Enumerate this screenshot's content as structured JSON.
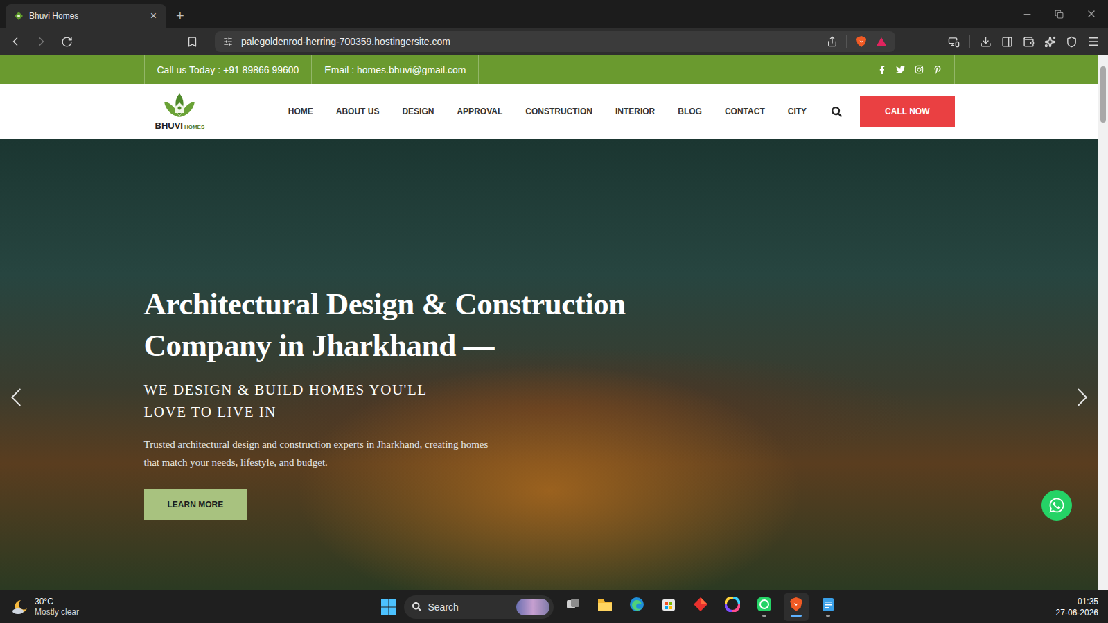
{
  "browser": {
    "tabs": [
      {
        "label": "Bhuvi Homes",
        "selected": true,
        "close": "×"
      }
    ],
    "new_tab": "+",
    "address": "palegoldenrod-herring-700359.hostingersite.com"
  },
  "site": {
    "topbar": {
      "phone": "Call us Today : +91 89866 99600",
      "email": "Email : homes.bhuvi@gmail.com"
    },
    "logo": {
      "name": "BHUVI",
      "suffix": "HOMES"
    },
    "nav": [
      "HOME",
      "ABOUT US",
      "DESIGN",
      "APPROVAL",
      "CONSTRUCTION",
      "INTERIOR",
      "BLOG",
      "CONTACT",
      "CITY"
    ],
    "cta": "CALL NOW",
    "hero": {
      "heading": [
        "Architectural Design & Construction",
        "Company in Jharkhand —"
      ],
      "subheading": [
        "WE DESIGN & BUILD HOMES YOU'LL",
        "LOVE TO LIVE IN"
      ],
      "text": [
        "Trusted architectural design and construction experts in Jharkhand, creating homes",
        "that match your needs, lifestyle, and budget."
      ],
      "button": "LEARN MORE"
    },
    "scrollbar": {
      "level": 0.11
    }
  },
  "taskbar": {
    "weather": {
      "temp": "30°C",
      "condition": "Mostly clear"
    },
    "search": "Search",
    "apps": [
      {
        "running": false,
        "active": false
      },
      {
        "running": false,
        "active": false
      },
      {
        "running": false,
        "active": false
      },
      {
        "running": false,
        "active": false
      },
      {
        "running": false,
        "active": false
      },
      {
        "running": false,
        "active": false
      },
      {
        "running": true,
        "active": false
      },
      {
        "running": true,
        "active": true
      },
      {
        "running": true,
        "active": false
      }
    ],
    "clock": {
      "time": "01:35",
      "date": "27-06-2026"
    }
  }
}
